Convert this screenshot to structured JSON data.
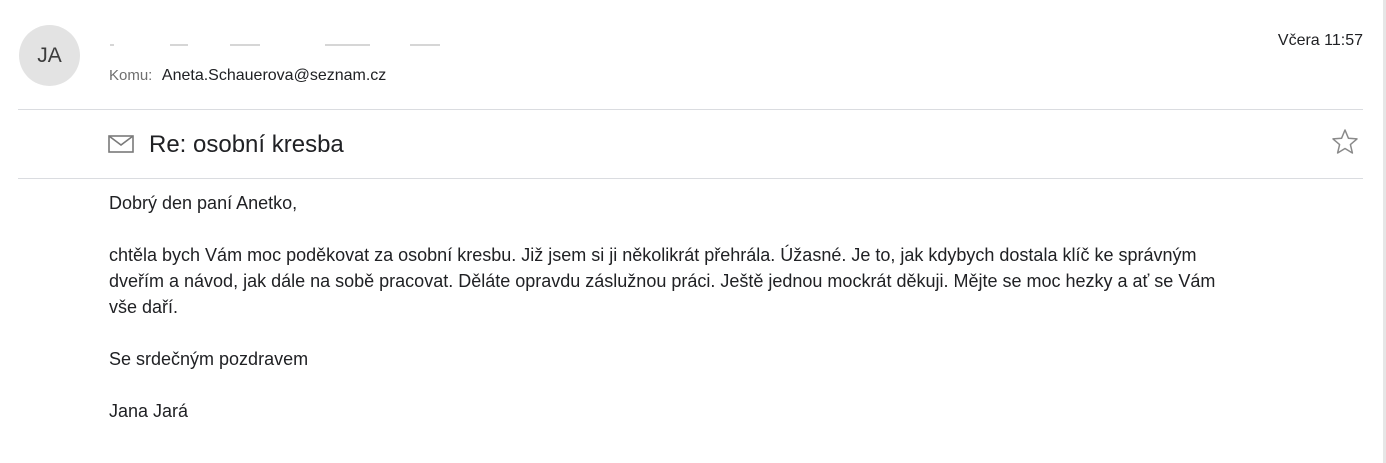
{
  "sender": {
    "initials": "JA"
  },
  "recipient": {
    "label": "Komu:",
    "address": "Aneta.Schauerova@seznam.cz"
  },
  "date": "Včera 11:57",
  "subject": "Re: osobní kresba",
  "icons": {
    "mail": "envelope-icon",
    "star": "star-icon"
  },
  "body": {
    "greeting": "Dobrý den paní Anetko,",
    "paragraph_lines": [
      "chtěla bych Vám moc poděkovat za osobní kresbu. Již jsem si ji několikrát přehrála. Úžasné. Je to, jak kdybych dostala klíč ke správným",
      "dveřím a návod, jak dále na sobě pracovat. Děláte opravdu záslužnou práci. Ještě jednou mockrát děkuji. Mějte se moc hezky a ať se Vám",
      "vše daří."
    ],
    "closing": "Se srdečným pozdravem",
    "signature": "Jana Jará"
  }
}
